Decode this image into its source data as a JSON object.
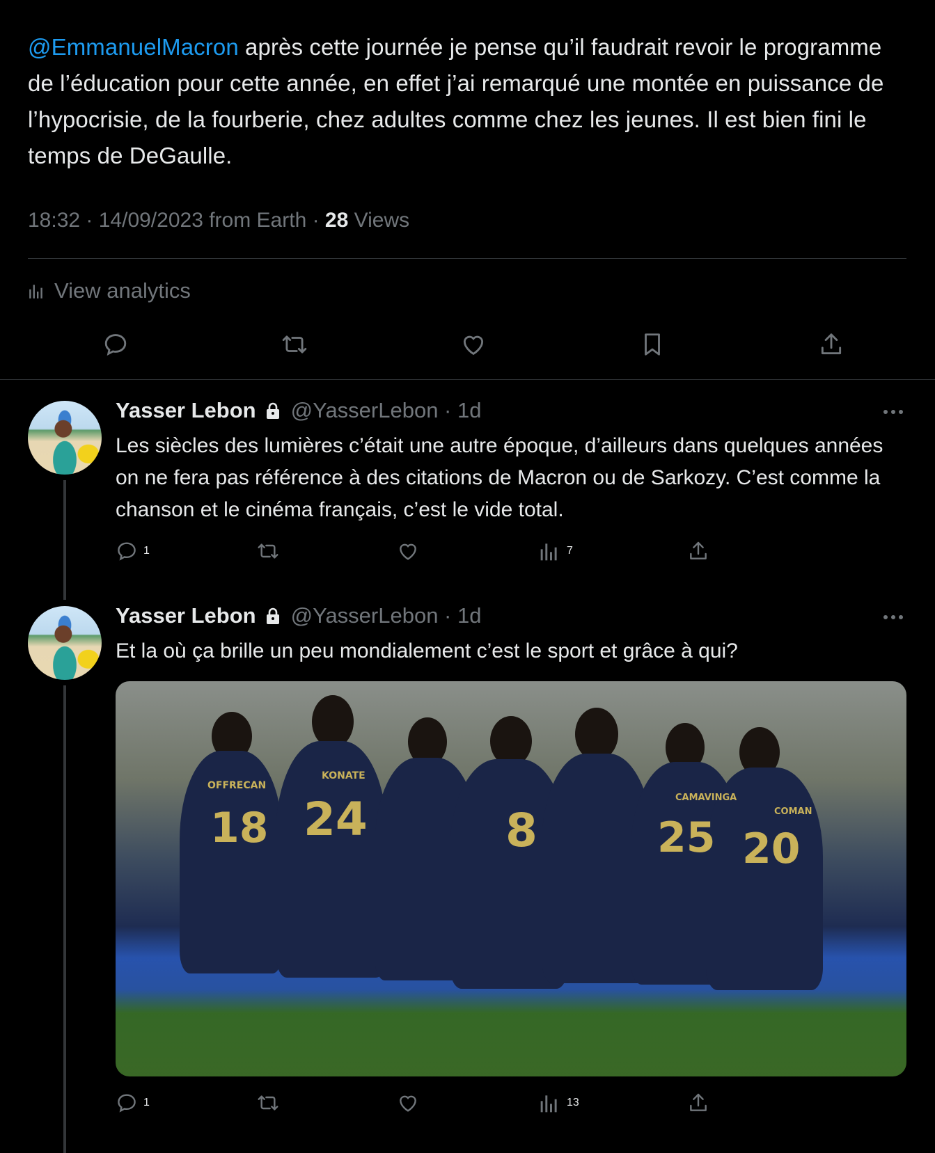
{
  "main_tweet": {
    "mention": "@EmmanuelMacron",
    "text": " après cette journée je pense qu’il faudrait revoir le programme de l’éducation pour cette année, en effet j’ai remarqué une montée en puissance de l’hypocrisie, de la fourberie, chez adultes comme chez les jeunes. Il est bien fini le temps de DeGaulle.",
    "meta_prefix": "18:32 · 14/09/2023 from Earth · ",
    "views_count": "28",
    "views_label": " Views",
    "analytics_label": "View analytics"
  },
  "replies": [
    {
      "name": "Yasser Lebon",
      "handle": "@YasserLebon · 1d",
      "text": "Les siècles des lumières c’était une autre époque, d’ailleurs dans quelques années on ne fera pas référence à des citations de Macron ou de Sarkozy. C’est comme la chanson et le cinéma français, c’est le vide total.",
      "reply_count": "1",
      "views_count": "7"
    },
    {
      "name": "Yasser Lebon",
      "handle": "@YasserLebon · 1d",
      "text": "Et la où ça brille un peu mondialement c’est le sport et grâce à qui?",
      "reply_count": "1",
      "views_count": "13",
      "photo_jersey_numbers": [
        "18",
        "24",
        "8",
        "25",
        "20"
      ],
      "photo_jersey_names": [
        "OFFRECAN",
        "KONATE",
        "CAMAVINGA",
        "COMAN"
      ]
    }
  ],
  "colors": {
    "accent": "#1d9bf0",
    "secondary_text": "#71767b",
    "divider": "#2f3336"
  }
}
